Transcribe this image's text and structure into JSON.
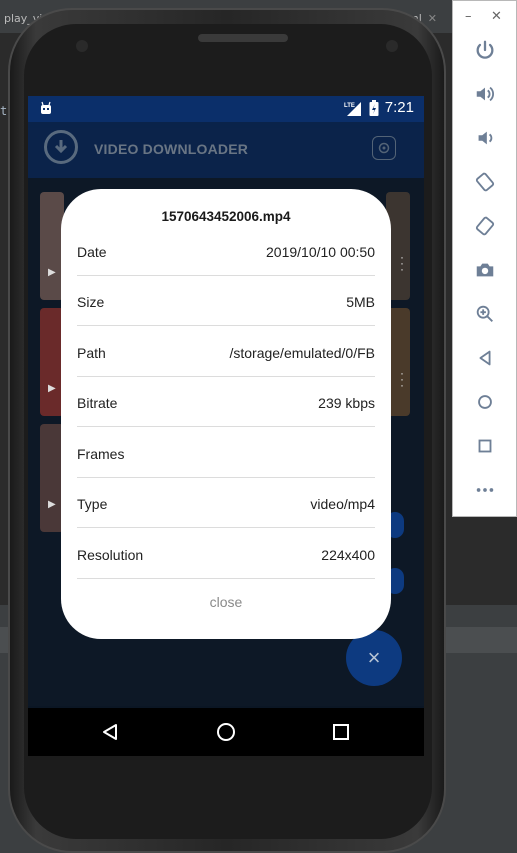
{
  "ide": {
    "tab1": "play_vid",
    "tab1_close": "✕",
    "tab2": "ml",
    "tab2_close": "✕",
    "side_letter": "t"
  },
  "emulator_toolbar": {
    "minimize": "–",
    "close": "✕",
    "buttons": [
      "power-icon",
      "volume-up-icon",
      "volume-down-icon",
      "rotate-left-icon",
      "rotate-right-icon",
      "camera-icon",
      "zoom-icon",
      "back-icon",
      "home-icon",
      "overview-icon",
      "more-icon"
    ]
  },
  "status_bar": {
    "time": "7:21",
    "network": "LTE"
  },
  "app_bar": {
    "title": "VIDEO DOWNLOADER"
  },
  "dialog": {
    "title": "1570643452006.mp4",
    "rows": [
      {
        "label": "Date",
        "value": "2019/10/10 00:50"
      },
      {
        "label": "Size",
        "value": "5MB"
      },
      {
        "label": "Path",
        "value": "/storage/emulated/0/FB"
      },
      {
        "label": "Bitrate",
        "value": "239 kbps"
      },
      {
        "label": "Frames",
        "value": ""
      },
      {
        "label": "Type",
        "value": "video/mp4"
      },
      {
        "label": "Resolution",
        "value": "224x400"
      }
    ],
    "close_label": "close"
  },
  "fab": {
    "label": "×"
  },
  "colors": {
    "app_bar": "#0b2f6a",
    "fab": "#0d3a80",
    "dialog_bg": "#ffffff"
  }
}
